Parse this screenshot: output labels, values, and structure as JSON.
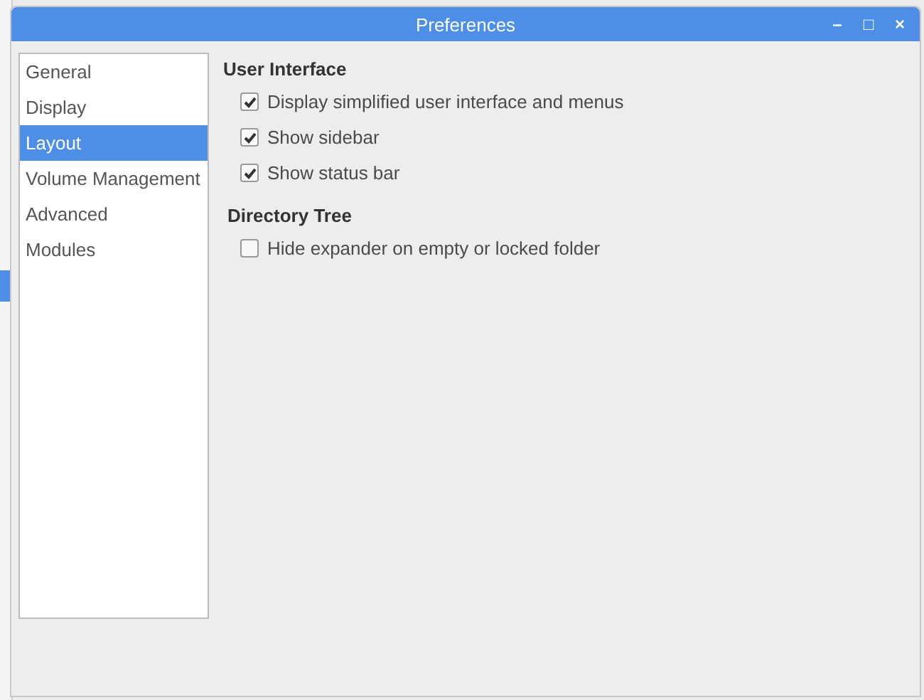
{
  "window": {
    "title": "Preferences",
    "controls": [
      "–",
      "□",
      "×"
    ]
  },
  "sidebar": {
    "items": [
      {
        "label": "General",
        "selected": false
      },
      {
        "label": "Display",
        "selected": false
      },
      {
        "label": "Layout",
        "selected": true
      },
      {
        "label": "Volume Management",
        "selected": false
      },
      {
        "label": "Advanced",
        "selected": false
      },
      {
        "label": "Modules",
        "selected": false
      }
    ]
  },
  "sections": [
    {
      "heading": "User Interface",
      "options": [
        {
          "label": "Display simplified user interface and menus",
          "checked": true
        },
        {
          "label": "Show sidebar",
          "checked": true
        },
        {
          "label": "Show status bar",
          "checked": true
        }
      ]
    },
    {
      "heading": "Directory Tree",
      "options": [
        {
          "label": "Hide expander on empty or locked folder",
          "checked": false
        }
      ]
    }
  ]
}
